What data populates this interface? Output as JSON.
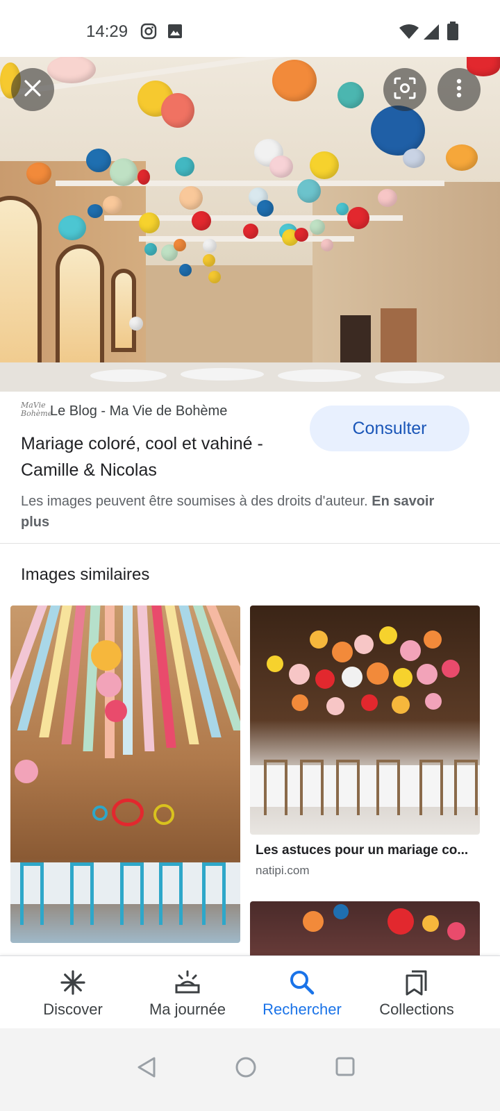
{
  "status_bar": {
    "time": "14:29",
    "left_icons": [
      "instagram-icon",
      "image-icon"
    ],
    "right_icons": [
      "wifi-icon",
      "signal-icon",
      "battery-icon"
    ]
  },
  "hero": {
    "close_icon": "close-icon",
    "lens_icon": "lens-icon",
    "more_icon": "more-vert-icon"
  },
  "result": {
    "source_logo": "MaVie Bohème",
    "source_name": "Le Blog - Ma Vie de Bohème",
    "title": "Mariage coloré, cool et vahiné - Camille & Nicolas",
    "consult_label": "Consulter",
    "copyright_text": "Les images peuvent être soumises à des droits d'auteur.",
    "learn_more": "En savoir plus"
  },
  "similar": {
    "title": "Images similaires",
    "items": [
      {
        "caption": "Les astuces pour un mariage co...",
        "domain": "natipi.com"
      }
    ]
  },
  "bottom_nav": {
    "items": [
      {
        "label": "Discover",
        "icon": "asterisk-icon",
        "active": false
      },
      {
        "label": "Ma journée",
        "icon": "sunrise-icon",
        "active": false
      },
      {
        "label": "Rechercher",
        "icon": "search-icon",
        "active": true
      },
      {
        "label": "Collections",
        "icon": "collections-icon",
        "active": false
      }
    ]
  },
  "system_nav": [
    "back-icon",
    "home-icon",
    "recents-icon"
  ],
  "colors": {
    "accent": "#1a73e8",
    "consult_bg": "#e8f0fe",
    "consult_text": "#1a56b8",
    "text_primary": "#202124",
    "text_secondary": "#5f6368"
  }
}
